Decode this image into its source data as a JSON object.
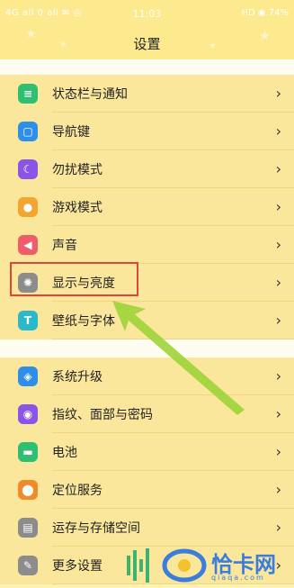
{
  "statusbar": {
    "left": "4G all 0 all ✉ ◎",
    "time": "11:03",
    "right": "HD ◉ 74%"
  },
  "header": {
    "title": "设置"
  },
  "group1": [
    {
      "label": "状态栏与通知",
      "icon": "status-bar-icon",
      "color": "#2fbf71",
      "glyph": "≡"
    },
    {
      "label": "导航键",
      "icon": "navigation-icon",
      "color": "#2f8fe8",
      "glyph": "▢"
    },
    {
      "label": "勿扰模式",
      "icon": "moon-icon",
      "color": "#8a55e6",
      "glyph": "☾"
    },
    {
      "label": "游戏模式",
      "icon": "gamepad-icon",
      "color": "#f2a533",
      "glyph": "●"
    },
    {
      "label": "声音",
      "icon": "speaker-icon",
      "color": "#ef5c6a",
      "glyph": "◀"
    },
    {
      "label": "显示与亮度",
      "icon": "brightness-icon",
      "color": "#8c8c8c",
      "glyph": "✺"
    },
    {
      "label": "壁纸与字体",
      "icon": "font-icon",
      "color": "#2bb8c9",
      "glyph": "T"
    }
  ],
  "group2": [
    {
      "label": "系统升级",
      "icon": "system-update-icon",
      "color": "#2f8fe8",
      "glyph": "◈"
    },
    {
      "label": "指纹、面部与密码",
      "icon": "fingerprint-icon",
      "color": "#8a55e6",
      "glyph": "◉"
    },
    {
      "label": "电池",
      "icon": "battery-icon",
      "color": "#2fbf71",
      "glyph": "▬"
    },
    {
      "label": "定位服务",
      "icon": "location-icon",
      "color": "#f08b2c",
      "glyph": "⬤"
    },
    {
      "label": "运存与存储空间",
      "icon": "storage-icon",
      "color": "#8c8c8c",
      "glyph": "▤"
    },
    {
      "label": "更多设置",
      "icon": "wrench-icon",
      "color": "#8c8c8c",
      "glyph": "✎"
    }
  ],
  "chevron": "›",
  "watermark": {
    "text": "恰卡网",
    "sub": "qiaqa.com"
  }
}
